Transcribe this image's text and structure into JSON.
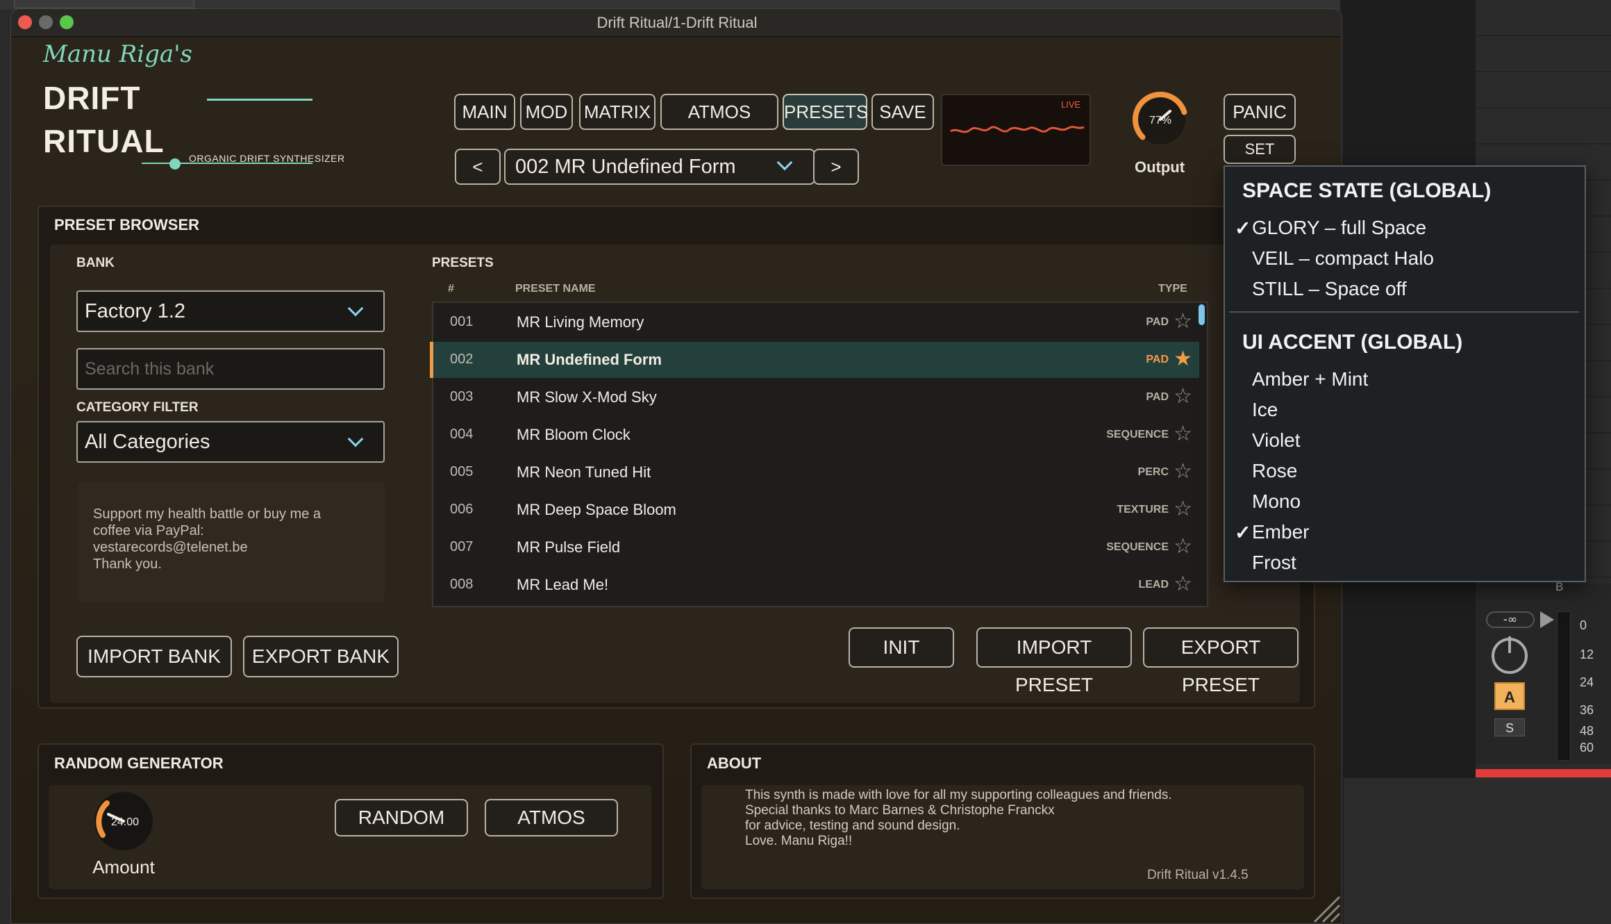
{
  "window": {
    "title": "Drift Ritual/1-Drift Ritual"
  },
  "host": {
    "mixer_inf": "-∞",
    "mixer_a": "A",
    "mixer_s": "S",
    "mixer_b": "B",
    "meter_scale": [
      "0",
      "12",
      "24",
      "36",
      "48",
      "60"
    ]
  },
  "logo": {
    "script": "Manu Riga's",
    "line1": "DRIFT",
    "line2": "RITUAL",
    "subtitle": "ORGANIC DRIFT SYNTHESIZER"
  },
  "nav": {
    "main": "MAIN",
    "mod": "MOD",
    "matrix": "MATRIX",
    "atmos": "ATMOS",
    "presets": "PRESETS",
    "save": "SAVE"
  },
  "preset_bar": {
    "prev": "<",
    "next": ">",
    "current": "002 MR Undefined Form"
  },
  "scope": {
    "live_label": "LIVE"
  },
  "output": {
    "value": "77%",
    "label": "Output",
    "level": 0.77
  },
  "actions": {
    "panic": "PANIC",
    "set": "SET"
  },
  "browser": {
    "title": "PRESET BROWSER",
    "bank_label": "BANK",
    "bank_value": "Factory 1.2",
    "search_placeholder": "Search this bank",
    "category_label": "CATEGORY FILTER",
    "category_value": "All Categories",
    "support_text": "Support my health battle or buy me a\ncoffee via PayPal:\nvestarecords@telenet.be\nThank you.",
    "presets_label": "PRESETS",
    "col_num": "#",
    "col_name": "PRESET NAME",
    "col_type": "TYPE",
    "rows": [
      {
        "num": "001",
        "name": "MR Living Memory",
        "type": "PAD",
        "star": "☆"
      },
      {
        "num": "002",
        "name": "MR Undefined Form",
        "type": "PAD",
        "star": "★"
      },
      {
        "num": "003",
        "name": "MR Slow X-Mod Sky",
        "type": "PAD",
        "star": "☆"
      },
      {
        "num": "004",
        "name": "MR Bloom Clock",
        "type": "SEQUENCE",
        "star": "☆"
      },
      {
        "num": "005",
        "name": "MR Neon Tuned Hit",
        "type": "PERC",
        "star": "☆"
      },
      {
        "num": "006",
        "name": "MR Deep Space Bloom",
        "type": "TEXTURE",
        "star": "☆"
      },
      {
        "num": "007",
        "name": "MR Pulse Field",
        "type": "SEQUENCE",
        "star": "☆"
      },
      {
        "num": "008",
        "name": "MR Lead Me!",
        "type": "LEAD",
        "star": "☆"
      }
    ],
    "import_bank": "IMPORT BANK",
    "export_bank": "EXPORT BANK",
    "init": "INIT",
    "import_preset": "IMPORT PRESET",
    "export_preset": "EXPORT PRESET"
  },
  "menu": {
    "space_header": "SPACE STATE (GLOBAL)",
    "space_items": [
      {
        "label": "GLORY  –  full Space",
        "checked": true
      },
      {
        "label": "VEIL  –  compact Halo",
        "checked": false
      },
      {
        "label": "STILL  –  Space off",
        "checked": false
      }
    ],
    "accent_header": "UI ACCENT (GLOBAL)",
    "accent_items": [
      {
        "label": "Amber + Mint",
        "checked": false
      },
      {
        "label": "Ice",
        "checked": false
      },
      {
        "label": "Violet",
        "checked": false
      },
      {
        "label": "Rose",
        "checked": false
      },
      {
        "label": "Mono",
        "checked": false
      },
      {
        "label": "Ember",
        "checked": true
      },
      {
        "label": "Frost",
        "checked": false
      }
    ],
    "check_glyph": "✓"
  },
  "random": {
    "title": "RANDOM GENERATOR",
    "knob_value": "24.00",
    "knob_label": "Amount",
    "random_btn": "RANDOM",
    "atmos_btn": "ATMOS"
  },
  "about": {
    "title": "ABOUT",
    "text": "This synth is made with love for all my supporting colleagues and friends.\nSpecial thanks to Marc Barnes & Christophe Franckx\nfor advice, testing and sound design.\nLove. Manu Riga!!",
    "version": "Drift Ritual v1.4.5"
  },
  "colors": {
    "accent_mint": "#7fd8bc",
    "accent_amber": "#f29a4a",
    "selection": "#24403c",
    "chevron": "#8ad4f2",
    "scope_wave": "#e0573a"
  },
  "icons": {
    "star_empty": "star-outline-icon",
    "star_filled": "star-filled-icon",
    "chevron": "chevron-down-icon"
  }
}
